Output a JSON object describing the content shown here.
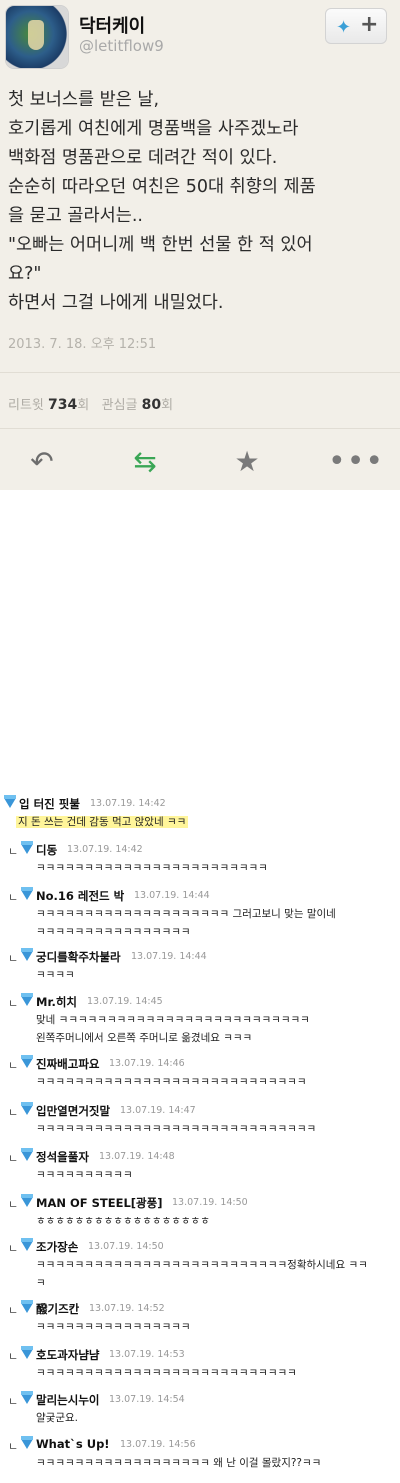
{
  "tweet": {
    "name": "닥터케이",
    "handle": "@letitflow9",
    "lines": [
      "첫 보너스를 받은 날,",
      "호기롭게 여친에게 명품백을 사주겠노라",
      "백화점 명품관으로 데려간 적이 있다.",
      "순순히 따라오던 여친은 50대 취향의 제품",
      "을 묻고 골라서는..",
      "\"오빠는 어머니께 백 한번 선물 한 적 있어",
      "요?\"",
      "하면서 그걸 나에게 내밀었다."
    ],
    "timestamp": "2013. 7. 18. 오후 12:51",
    "retweet_label": "리트윗",
    "retweet_count": "734",
    "retweet_unit": "회",
    "fav_label": "관심글",
    "fav_count": "80",
    "fav_unit": "회",
    "icons": [
      "reply-icon",
      "retweet-icon",
      "favorite-star-icon",
      "more-dots-icon",
      "twitter-bird-icon"
    ],
    "colors": {
      "retweet": "#3aa655",
      "bird": "#3a9fd6"
    }
  },
  "comments": [
    {
      "nick": "입 터진 핏불",
      "date": "13.07.19. 14:42",
      "reply": false,
      "lines": [
        "지 돈 쓰는 건데 감동 먹고 앉았네 ㅋㅋ"
      ],
      "highlight": true
    },
    {
      "nick": "디동",
      "date": "13.07.19. 14:42",
      "reply": true,
      "lines": [
        "ㅋㅋㅋㅋㅋㅋㅋㅋㅋㅋㅋㅋㅋㅋㅋㅋㅋㅋㅋㅋㅋㅋㅋㅋ"
      ]
    },
    {
      "nick": "No.16 레전드 박",
      "date": "13.07.19. 14:44",
      "reply": true,
      "lines": [
        "ㅋㅋㅋㅋㅋㅋㅋㅋㅋㅋㅋㅋㅋㅋㅋㅋㅋㅋㅋㅋ 그러고보니 맞는 말이네",
        "ㅋㅋㅋㅋㅋㅋㅋㅋㅋㅋㅋㅋㅋㅋㅋㅋ"
      ]
    },
    {
      "nick": "궁디를확주차불라",
      "date": "13.07.19. 14:44",
      "reply": true,
      "lines": [
        "ㅋㅋㅋㅋ"
      ]
    },
    {
      "nick": "Mr.히치",
      "date": "13.07.19. 14:45",
      "reply": true,
      "lines": [
        "맞네 ㅋㅋㅋㅋㅋㅋㅋㅋㅋㅋㅋㅋㅋㅋㅋㅋㅋㅋㅋㅋㅋㅋㅋㅋㅋㅋ",
        "왼쪽주머니에서 오른쪽 주머니로 옮겼네요 ㅋㅋㅋ"
      ]
    },
    {
      "nick": "진짜배고파요",
      "date": "13.07.19. 14:46",
      "reply": true,
      "lines": [
        "ㅋㅋㅋㅋㅋㅋㅋㅋㅋㅋㅋㅋㅋㅋㅋㅋㅋㅋㅋㅋㅋㅋㅋㅋㅋㅋㅋㅋ"
      ]
    },
    {
      "nick": "입만열면거짓말",
      "date": "13.07.19. 14:47",
      "reply": true,
      "lines": [
        "ㅋㅋㅋㅋㅋㅋㅋㅋㅋㅋㅋㅋㅋㅋㅋㅋㅋㅋㅋㅋㅋㅋㅋㅋㅋㅋㅋㅋㅋ"
      ]
    },
    {
      "nick": "정석을풀자",
      "date": "13.07.19. 14:48",
      "reply": true,
      "lines": [
        "ㅋㅋㅋㅋㅋㅋㅋㅋㅋㅋ"
      ]
    },
    {
      "nick": "MAN OF STEEL[광풍]",
      "date": "13.07.19. 14:50",
      "reply": true,
      "lines": [
        "ㅎㅎㅎㅎㅎㅎㅎㅎㅎㅎㅎㅎㅎㅎㅎㅎㅎㅎ"
      ]
    },
    {
      "nick": "조가장손",
      "date": "13.07.19. 14:50",
      "reply": true,
      "lines": [
        "ㅋㅋㅋㅋㅋㅋㅋㅋㅋㅋㅋㅋㅋㅋㅋㅋㅋㅋㅋㅋㅋㅋㅋㅋㅋㅋ정확하시네요 ㅋㅋ",
        "ㅋ"
      ]
    },
    {
      "nick": "醱기즈칸",
      "date": "13.07.19. 14:52",
      "reply": true,
      "lines": [
        "ㅋㅋㅋㅋㅋㅋㅋㅋㅋㅋㅋㅋㅋㅋㅋㅋ"
      ]
    },
    {
      "nick": "호도과자냠냠",
      "date": "13.07.19. 14:53",
      "reply": true,
      "lines": [
        "ㅋㅋㅋㅋㅋㅋㅋㅋㅋㅋㅋㅋㅋㅋㅋㅋㅋㅋㅋㅋㅋㅋㅋㅋㅋㅋㅋ"
      ]
    },
    {
      "nick": "말리는시누이",
      "date": "13.07.19. 14:54",
      "reply": true,
      "lines": [
        "얄궂군요."
      ]
    },
    {
      "nick": "What`s Up!",
      "date": "13.07.19. 14:56",
      "reply": true,
      "lines": [
        "ㅋㅋㅋㅋㅋㅋㅋㅋㅋㅋㅋㅋㅋㅋㅋㅋㅋㅋ 왜 난 이걸 몰랐지??ㅋㅋ"
      ]
    }
  ]
}
